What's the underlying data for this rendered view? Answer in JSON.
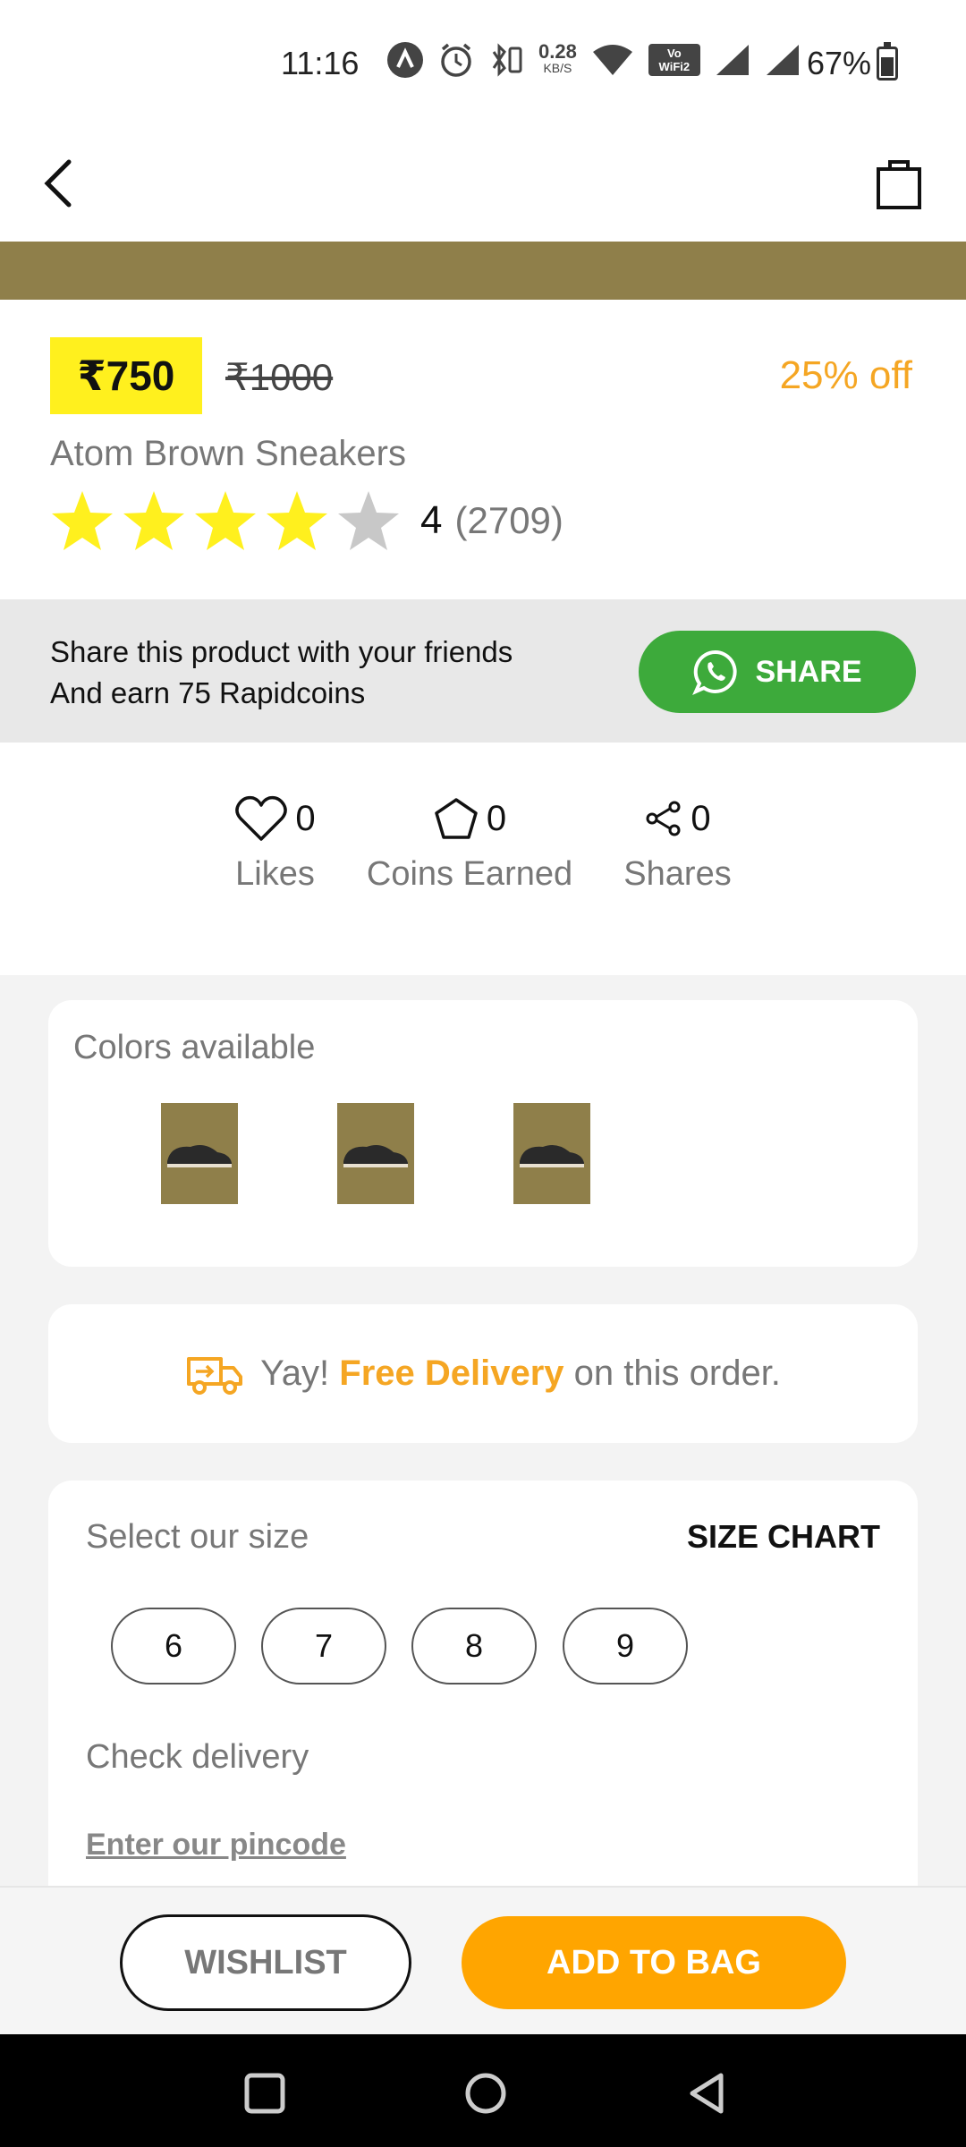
{
  "status_bar": {
    "time": "11:16",
    "net_speed": "0.28",
    "net_unit": "KB/S",
    "wifi_label_top": "Vo",
    "wifi_label_bottom": "WiFi2",
    "battery_text": "67%",
    "battery_level": 0.67
  },
  "app_bar": {
    "back_icon": "chevron-left-icon",
    "bag_icon": "shopping-bag-icon"
  },
  "product": {
    "price": "₹750",
    "mrp": "₹1000",
    "discount": "25% off",
    "name": "Atom Brown Sneakers",
    "rating_value": "4",
    "rating_count": "(2709)",
    "stars_filled": 4,
    "stars_total": 5
  },
  "share": {
    "line1": "Share this product with your friends",
    "line2": "And earn 75 Rapidcoins",
    "button_label": "SHARE"
  },
  "stats": {
    "likes_count": "0",
    "likes_label": "Likes",
    "coins_count": "0",
    "coins_label": "Coins Earned",
    "shares_count": "0",
    "shares_label": "Shares"
  },
  "colors": {
    "title": "Colors available"
  },
  "delivery": {
    "prefix": "Yay!",
    "highlight": "Free Delivery",
    "suffix": "on this order."
  },
  "size": {
    "title": "Select our size",
    "chart_label": "SIZE CHART",
    "options": [
      "6",
      "7",
      "8",
      "9"
    ],
    "check_title": "Check delivery",
    "pincode_link": "Enter our pincode"
  },
  "actions": {
    "wishlist": "WISHLIST",
    "add_to_bag": "ADD TO BAG"
  },
  "theme": {
    "price_badge": "#fff01e",
    "accent_orange": "#ffa500",
    "share_green": "#3daa3b",
    "product_bg": "#8f7f4a"
  }
}
